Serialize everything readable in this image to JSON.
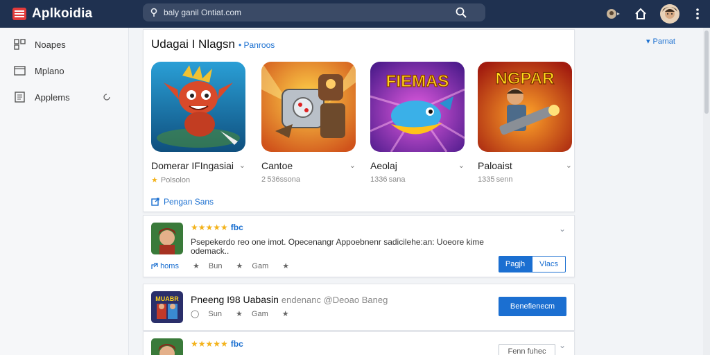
{
  "app": {
    "name": "Aplkoidia"
  },
  "search": {
    "placeholder": "baly ganil Ontiat.com"
  },
  "sidebar": {
    "items": [
      {
        "label": "Noapes"
      },
      {
        "label": "Mplano"
      },
      {
        "label": "Applems"
      }
    ]
  },
  "featured": {
    "title": "Udagai I Nlagsn",
    "link": "Panroos",
    "apps": [
      {
        "name": "Domerar IFIngasiai",
        "meta": "Polsolon",
        "has_star": true
      },
      {
        "name": "Cantoe",
        "meta": "2 536ssona"
      },
      {
        "name": "Aeolaj",
        "meta": "1336 sana"
      },
      {
        "name": "Paloaist",
        "meta": "1335 senn"
      }
    ],
    "footer_link": "Pengan Sans",
    "icon_texts": {
      "app3": "FIEMAS",
      "app4": "NGPAR"
    }
  },
  "right_link": "Parnat",
  "review1": {
    "tag": "fbc",
    "text": "Psepekerdo reo one imot. Opecenangr Appoebnenr sadicilehe:an: Uoeore kime odemack..",
    "meta": {
      "link": "homs",
      "stat1": "Bun",
      "stat2": "Gam"
    },
    "btn_primary": "Pagjh",
    "btn_secondary": "Vlacs"
  },
  "listing": {
    "title": "Pneeng I98 Uabasin",
    "subtitle": "endenanc @Deoao Baneg",
    "meta": {
      "stat1": "Sun",
      "stat2": "Gam"
    },
    "button": "Benefienecm",
    "icon_text": "MUABR"
  },
  "review2": {
    "tag": "fbc",
    "button": "Fenn fuhec"
  },
  "colors": {
    "topbar": "#1f3150",
    "accent": "#1b6fd1",
    "star": "#f3b21a"
  }
}
